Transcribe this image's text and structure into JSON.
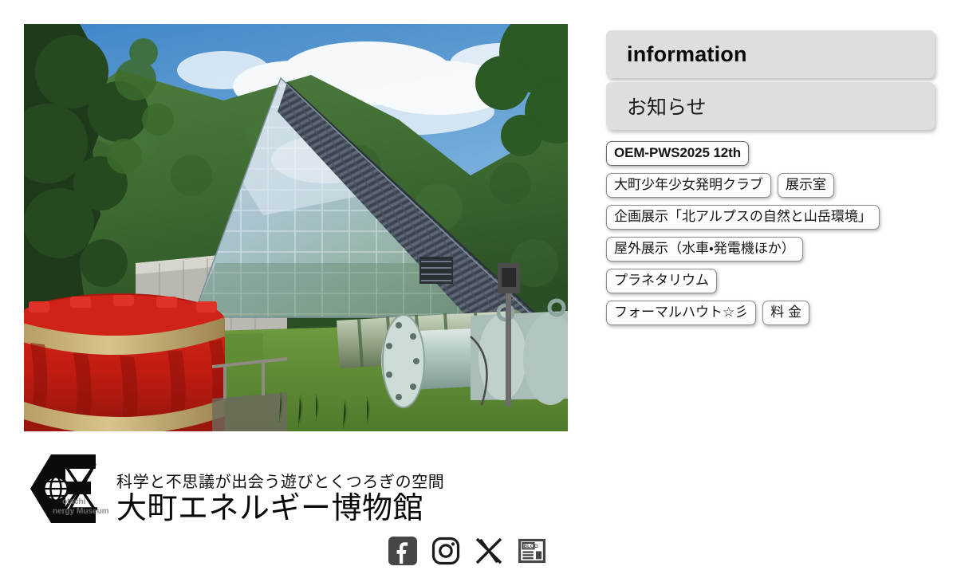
{
  "site": {
    "name": "大町エネルギー博物館",
    "tagline": "科学と不思議が出会う遊びとくつろぎの空間",
    "logo_mark_text": "otachi nergy Museum"
  },
  "hero": {
    "alt": "大町エネルギー博物館 ガラスのピラミッド建物と赤い水車ランナー",
    "caption": ""
  },
  "information": {
    "heading": "information",
    "subheading": "お知らせ"
  },
  "tags": [
    {
      "label": "OEM-PWS2025 12th",
      "featured": true
    },
    {
      "label": "大町少年少女発明クラブ",
      "featured": false
    },
    {
      "label": "展示室",
      "featured": false
    },
    {
      "label": "企画展示「北アルプスの自然と山岳環境」",
      "featured": false
    },
    {
      "label": "屋外展示（水車・発電機ほか）",
      "featured": false
    },
    {
      "label": "プラネタリウム",
      "featured": false
    },
    {
      "label": "フォーマルハウト☆彡",
      "featured": false
    },
    {
      "label": "料 金",
      "featured": false
    }
  ],
  "social": [
    {
      "name": "facebook",
      "label": "Facebook"
    },
    {
      "name": "instagram",
      "label": "Instagram"
    },
    {
      "name": "x-twitter",
      "label": "X"
    },
    {
      "name": "blog",
      "label": "BLOG"
    }
  ],
  "colors": {
    "bar_background": "#dededf",
    "tag_background": "#fdfdfd",
    "tag_border": "#8d8d8d",
    "text": "#111111",
    "page_background": "#ffffff"
  }
}
